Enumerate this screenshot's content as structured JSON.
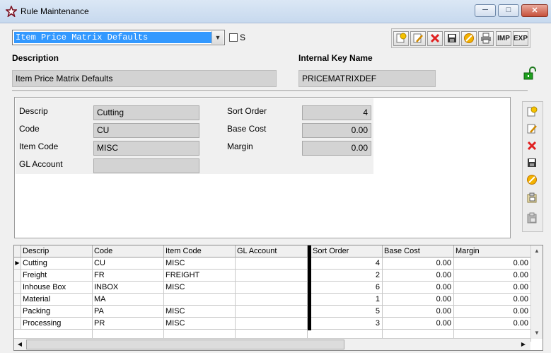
{
  "window": {
    "title": "Rule Maintenance",
    "app_icon": "star-icon"
  },
  "selector": {
    "value": "Item Price Matrix Defaults",
    "checkbox_label": "S"
  },
  "toolbar": {
    "buttons": [
      "new-icon",
      "edit-icon",
      "delete-icon",
      "save-icon",
      "cancel-icon",
      "print-icon"
    ],
    "imp_label": "IMP",
    "exp_label": "EXP"
  },
  "header": {
    "description_label": "Description",
    "description_value": "Item Price Matrix Defaults",
    "key_label": "Internal Key Name",
    "key_value": "PRICEMATRIXDEF"
  },
  "form": {
    "descrip_label": "Descrip",
    "descrip_value": "Cutting",
    "code_label": "Code",
    "code_value": "CU",
    "item_code_label": "Item Code",
    "item_code_value": "MISC",
    "gl_label": "GL Account",
    "gl_value": "",
    "sort_label": "Sort Order",
    "sort_value": "4",
    "base_cost_label": "Base Cost",
    "base_cost_value": "0.00",
    "margin_label": "Margin",
    "margin_value": "0.00"
  },
  "grid": {
    "columns": [
      "Descrip",
      "Code",
      "Item Code",
      "GL Account",
      "Sort Order",
      "Base Cost",
      "Margin"
    ],
    "rows": [
      {
        "descrip": "Cutting",
        "code": "CU",
        "item": "MISC",
        "gl": "",
        "sort": "4",
        "base": "0.00",
        "margin": "0.00"
      },
      {
        "descrip": "Freight",
        "code": "FR",
        "item": "FREIGHT",
        "gl": "",
        "sort": "2",
        "base": "0.00",
        "margin": "0.00"
      },
      {
        "descrip": "Inhouse Box",
        "code": "INBOX",
        "item": "MISC",
        "gl": "",
        "sort": "6",
        "base": "0.00",
        "margin": "0.00"
      },
      {
        "descrip": "Material",
        "code": "MA",
        "item": "",
        "gl": "",
        "sort": "1",
        "base": "0.00",
        "margin": "0.00"
      },
      {
        "descrip": "Packing",
        "code": "PA",
        "item": "MISC",
        "gl": "",
        "sort": "5",
        "base": "0.00",
        "margin": "0.00"
      },
      {
        "descrip": "Processing",
        "code": "PR",
        "item": "MISC",
        "gl": "",
        "sort": "3",
        "base": "0.00",
        "margin": "0.00"
      }
    ]
  },
  "colors": {
    "selection": "#3399ff",
    "readonly_field": "#d3d3d3"
  }
}
